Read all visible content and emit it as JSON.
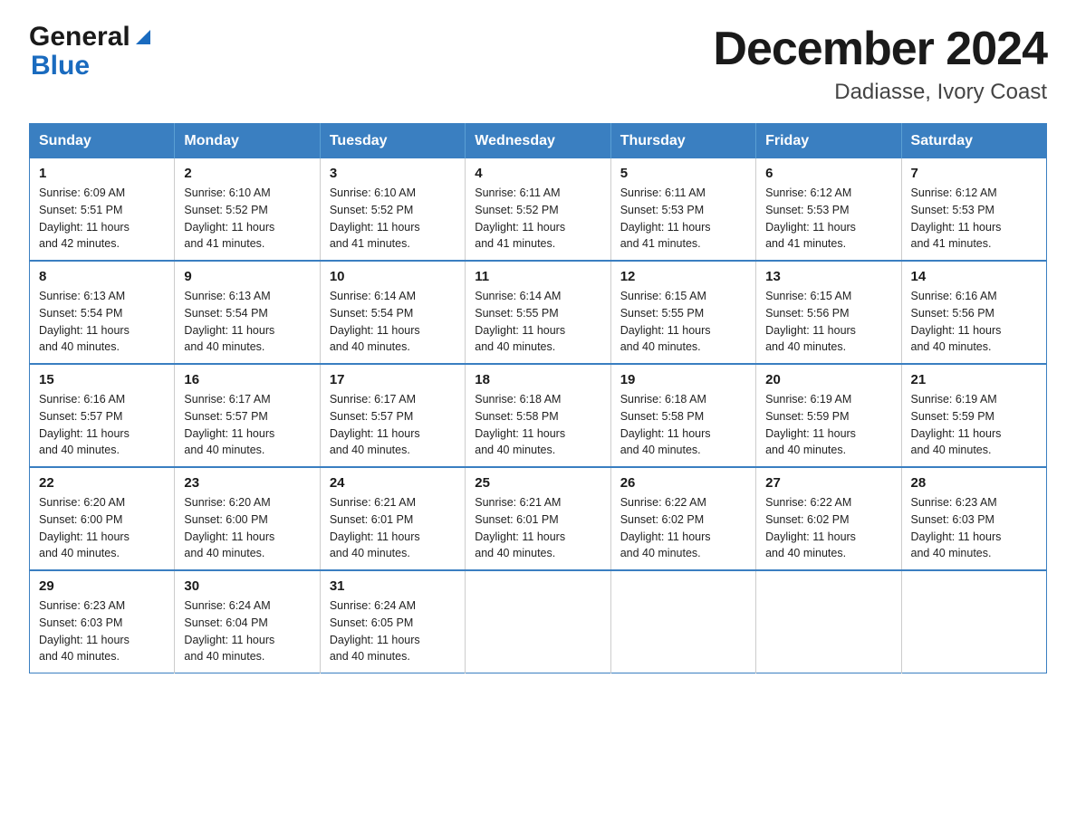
{
  "logo": {
    "general": "General",
    "blue": "Blue"
  },
  "header": {
    "title": "December 2024",
    "subtitle": "Dadiasse, Ivory Coast"
  },
  "columns": [
    "Sunday",
    "Monday",
    "Tuesday",
    "Wednesday",
    "Thursday",
    "Friday",
    "Saturday"
  ],
  "weeks": [
    [
      {
        "day": "1",
        "sunrise": "Sunrise: 6:09 AM",
        "sunset": "Sunset: 5:51 PM",
        "daylight": "Daylight: 11 hours",
        "daylight2": "and 42 minutes."
      },
      {
        "day": "2",
        "sunrise": "Sunrise: 6:10 AM",
        "sunset": "Sunset: 5:52 PM",
        "daylight": "Daylight: 11 hours",
        "daylight2": "and 41 minutes."
      },
      {
        "day": "3",
        "sunrise": "Sunrise: 6:10 AM",
        "sunset": "Sunset: 5:52 PM",
        "daylight": "Daylight: 11 hours",
        "daylight2": "and 41 minutes."
      },
      {
        "day": "4",
        "sunrise": "Sunrise: 6:11 AM",
        "sunset": "Sunset: 5:52 PM",
        "daylight": "Daylight: 11 hours",
        "daylight2": "and 41 minutes."
      },
      {
        "day": "5",
        "sunrise": "Sunrise: 6:11 AM",
        "sunset": "Sunset: 5:53 PM",
        "daylight": "Daylight: 11 hours",
        "daylight2": "and 41 minutes."
      },
      {
        "day": "6",
        "sunrise": "Sunrise: 6:12 AM",
        "sunset": "Sunset: 5:53 PM",
        "daylight": "Daylight: 11 hours",
        "daylight2": "and 41 minutes."
      },
      {
        "day": "7",
        "sunrise": "Sunrise: 6:12 AM",
        "sunset": "Sunset: 5:53 PM",
        "daylight": "Daylight: 11 hours",
        "daylight2": "and 41 minutes."
      }
    ],
    [
      {
        "day": "8",
        "sunrise": "Sunrise: 6:13 AM",
        "sunset": "Sunset: 5:54 PM",
        "daylight": "Daylight: 11 hours",
        "daylight2": "and 40 minutes."
      },
      {
        "day": "9",
        "sunrise": "Sunrise: 6:13 AM",
        "sunset": "Sunset: 5:54 PM",
        "daylight": "Daylight: 11 hours",
        "daylight2": "and 40 minutes."
      },
      {
        "day": "10",
        "sunrise": "Sunrise: 6:14 AM",
        "sunset": "Sunset: 5:54 PM",
        "daylight": "Daylight: 11 hours",
        "daylight2": "and 40 minutes."
      },
      {
        "day": "11",
        "sunrise": "Sunrise: 6:14 AM",
        "sunset": "Sunset: 5:55 PM",
        "daylight": "Daylight: 11 hours",
        "daylight2": "and 40 minutes."
      },
      {
        "day": "12",
        "sunrise": "Sunrise: 6:15 AM",
        "sunset": "Sunset: 5:55 PM",
        "daylight": "Daylight: 11 hours",
        "daylight2": "and 40 minutes."
      },
      {
        "day": "13",
        "sunrise": "Sunrise: 6:15 AM",
        "sunset": "Sunset: 5:56 PM",
        "daylight": "Daylight: 11 hours",
        "daylight2": "and 40 minutes."
      },
      {
        "day": "14",
        "sunrise": "Sunrise: 6:16 AM",
        "sunset": "Sunset: 5:56 PM",
        "daylight": "Daylight: 11 hours",
        "daylight2": "and 40 minutes."
      }
    ],
    [
      {
        "day": "15",
        "sunrise": "Sunrise: 6:16 AM",
        "sunset": "Sunset: 5:57 PM",
        "daylight": "Daylight: 11 hours",
        "daylight2": "and 40 minutes."
      },
      {
        "day": "16",
        "sunrise": "Sunrise: 6:17 AM",
        "sunset": "Sunset: 5:57 PM",
        "daylight": "Daylight: 11 hours",
        "daylight2": "and 40 minutes."
      },
      {
        "day": "17",
        "sunrise": "Sunrise: 6:17 AM",
        "sunset": "Sunset: 5:57 PM",
        "daylight": "Daylight: 11 hours",
        "daylight2": "and 40 minutes."
      },
      {
        "day": "18",
        "sunrise": "Sunrise: 6:18 AM",
        "sunset": "Sunset: 5:58 PM",
        "daylight": "Daylight: 11 hours",
        "daylight2": "and 40 minutes."
      },
      {
        "day": "19",
        "sunrise": "Sunrise: 6:18 AM",
        "sunset": "Sunset: 5:58 PM",
        "daylight": "Daylight: 11 hours",
        "daylight2": "and 40 minutes."
      },
      {
        "day": "20",
        "sunrise": "Sunrise: 6:19 AM",
        "sunset": "Sunset: 5:59 PM",
        "daylight": "Daylight: 11 hours",
        "daylight2": "and 40 minutes."
      },
      {
        "day": "21",
        "sunrise": "Sunrise: 6:19 AM",
        "sunset": "Sunset: 5:59 PM",
        "daylight": "Daylight: 11 hours",
        "daylight2": "and 40 minutes."
      }
    ],
    [
      {
        "day": "22",
        "sunrise": "Sunrise: 6:20 AM",
        "sunset": "Sunset: 6:00 PM",
        "daylight": "Daylight: 11 hours",
        "daylight2": "and 40 minutes."
      },
      {
        "day": "23",
        "sunrise": "Sunrise: 6:20 AM",
        "sunset": "Sunset: 6:00 PM",
        "daylight": "Daylight: 11 hours",
        "daylight2": "and 40 minutes."
      },
      {
        "day": "24",
        "sunrise": "Sunrise: 6:21 AM",
        "sunset": "Sunset: 6:01 PM",
        "daylight": "Daylight: 11 hours",
        "daylight2": "and 40 minutes."
      },
      {
        "day": "25",
        "sunrise": "Sunrise: 6:21 AM",
        "sunset": "Sunset: 6:01 PM",
        "daylight": "Daylight: 11 hours",
        "daylight2": "and 40 minutes."
      },
      {
        "day": "26",
        "sunrise": "Sunrise: 6:22 AM",
        "sunset": "Sunset: 6:02 PM",
        "daylight": "Daylight: 11 hours",
        "daylight2": "and 40 minutes."
      },
      {
        "day": "27",
        "sunrise": "Sunrise: 6:22 AM",
        "sunset": "Sunset: 6:02 PM",
        "daylight": "Daylight: 11 hours",
        "daylight2": "and 40 minutes."
      },
      {
        "day": "28",
        "sunrise": "Sunrise: 6:23 AM",
        "sunset": "Sunset: 6:03 PM",
        "daylight": "Daylight: 11 hours",
        "daylight2": "and 40 minutes."
      }
    ],
    [
      {
        "day": "29",
        "sunrise": "Sunrise: 6:23 AM",
        "sunset": "Sunset: 6:03 PM",
        "daylight": "Daylight: 11 hours",
        "daylight2": "and 40 minutes."
      },
      {
        "day": "30",
        "sunrise": "Sunrise: 6:24 AM",
        "sunset": "Sunset: 6:04 PM",
        "daylight": "Daylight: 11 hours",
        "daylight2": "and 40 minutes."
      },
      {
        "day": "31",
        "sunrise": "Sunrise: 6:24 AM",
        "sunset": "Sunset: 6:05 PM",
        "daylight": "Daylight: 11 hours",
        "daylight2": "and 40 minutes."
      },
      null,
      null,
      null,
      null
    ]
  ]
}
